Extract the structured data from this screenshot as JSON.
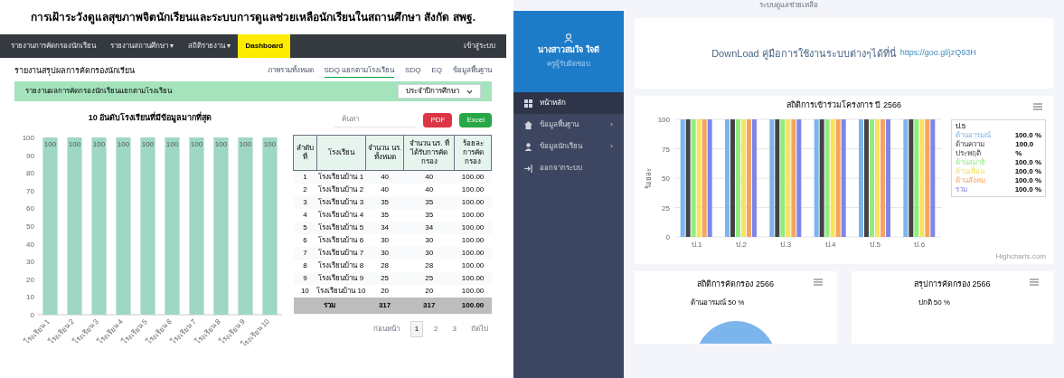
{
  "left_page": {
    "title": "การเฝ้าระวังดูแลสุขภาพจิตนักเรียนและระบบการดูแลช่วยเหลือนักเรียนในสถานศึกษา สังกัด สพฐ.",
    "nav": [
      {
        "label": "รายงานการคัดกรองนักเรียน",
        "selected": false
      },
      {
        "label": "รายงานสถานศึกษา",
        "caret": "▾",
        "selected": false
      },
      {
        "label": "สถิติรายงาน",
        "caret": "▾",
        "selected": false
      },
      {
        "label": "Dashboard",
        "selected": true
      },
      {
        "label": "เข้าสู่ระบบ",
        "selected": false
      }
    ],
    "heading": "รายงานสรุปผลการคัดกรองนักเรียน",
    "tabs": [
      {
        "label": "ภาพรวมทั้งหมด",
        "selected": false
      },
      {
        "label": "SDQ แยกตามโรงเรียน",
        "selected": true
      },
      {
        "label": "SDQ",
        "selected": false
      },
      {
        "label": "EQ",
        "selected": false
      },
      {
        "label": "ข้อมูลพื้นฐาน",
        "selected": false
      }
    ],
    "banner": "รายงานผลการคัดกรองนักเรียนแยกตามโรงเรียน",
    "select_value": "ประจำปีการศึกษา",
    "chart": {
      "chart_data": {
        "type": "bar",
        "title": "10 อันดับโรงเรียนที่มีข้อมูลมากที่สุด",
        "categories": [
          "โรงเรียน 1",
          "โรงเรียน 2",
          "โรงเรียน 3",
          "โรงเรียน 4",
          "โรงเรียน 5",
          "โรงเรียน 6",
          "โรงเรียน 7",
          "โรงเรียน 8",
          "โรงเรียน 9",
          "โรงเรียน 10"
        ],
        "values": [
          100,
          100,
          100,
          100,
          100,
          100,
          100,
          100,
          100,
          100
        ],
        "ylim": [
          0,
          100
        ],
        "yticks": [
          0,
          10,
          20,
          30,
          40,
          50,
          60,
          70,
          80,
          90,
          100
        ],
        "data_labels": true
      }
    },
    "search_placeholder": "ค้นหา",
    "buttons": [
      {
        "label": "PDF",
        "kind": "pdf"
      },
      {
        "label": "Excel",
        "kind": "excel"
      }
    ],
    "table": {
      "columns": [
        "ลำดับที่",
        "โรงเรียน",
        "จำนวน นร. ทั้งหมด",
        "จำนวน นร. ที่ได้รับการคัดกรอง",
        "ร้อยละ การคัดกรอง"
      ],
      "rows": [
        [
          "1",
          "โรงเรียนบ้าน 1",
          "40",
          "40",
          "100.00"
        ],
        [
          "2",
          "โรงเรียนบ้าน 2",
          "40",
          "40",
          "100.00"
        ],
        [
          "3",
          "โรงเรียนบ้าน 3",
          "35",
          "35",
          "100.00"
        ],
        [
          "4",
          "โรงเรียนบ้าน 4",
          "35",
          "35",
          "100.00"
        ],
        [
          "5",
          "โรงเรียนบ้าน 5",
          "34",
          "34",
          "100.00"
        ],
        [
          "6",
          "โรงเรียนบ้าน 6",
          "30",
          "30",
          "100.00"
        ],
        [
          "7",
          "โรงเรียนบ้าน 7",
          "30",
          "30",
          "100.00"
        ],
        [
          "8",
          "โรงเรียนบ้าน 8",
          "28",
          "28",
          "100.00"
        ],
        [
          "9",
          "โรงเรียนบ้าน 9",
          "25",
          "25",
          "100.00"
        ],
        [
          "10",
          "โรงเรียนบ้าน 10",
          "20",
          "20",
          "100.00"
        ]
      ],
      "total": [
        "รวม",
        "317",
        "317",
        "100.00"
      ]
    },
    "pagination": [
      {
        "label": "ก่อนหน้า",
        "selected": false
      },
      {
        "label": "1",
        "selected": true
      },
      {
        "label": "2",
        "selected": false
      },
      {
        "label": "3",
        "selected": false
      },
      {
        "label": "ถัดไป",
        "selected": false
      }
    ]
  },
  "right_page": {
    "top_text": "ระบบดูแลช่วยเหลือ",
    "profile": {
      "name": "นางสาวสมใจ ใจดี",
      "role": "ครูผู้รับผิดชอบ"
    },
    "menu": [
      {
        "label": "หน้าหลัก",
        "selected": true
      },
      {
        "label": "ข้อมูลพื้นฐาน",
        "chevron": "›",
        "selected": false
      },
      {
        "label": "ข้อมูลนักเรียน",
        "chevron": "›",
        "selected": false
      },
      {
        "label": "ออกจากระบบ",
        "selected": false
      }
    ],
    "banner": {
      "text": "DownLoad คู่มือการใช้งานระบบต่างๆได้ที่นี่",
      "link": "https://goo.gl/jzQ93H"
    },
    "chart": {
      "chart_data": {
        "type": "bar",
        "title": "สถิติการเข้าร่วมโครงการ ปี 2566",
        "ylabel": "ร้อยละ",
        "categories": [
          "ป.1",
          "ป.2",
          "ป.3",
          "ป.4",
          "ป.5",
          "ป.6"
        ],
        "ylim": [
          0,
          100
        ],
        "yticks": [
          0,
          25,
          50,
          75,
          100
        ],
        "grid": true,
        "series": [
          {
            "name": "ด้านอารมณ์",
            "color": "#7cb5ec",
            "values": [
              100,
              100,
              100,
              100,
              100,
              100
            ]
          },
          {
            "name": "ด้านความประพฤติ",
            "color": "#434348",
            "values": [
              100,
              100,
              100,
              100,
              100,
              100
            ]
          },
          {
            "name": "ด้านสมาธิ",
            "color": "#90ed7d",
            "values": [
              100,
              100,
              100,
              100,
              100,
              100
            ]
          },
          {
            "name": "ด้านเพื่อน",
            "color": "#f7e35c",
            "values": [
              100,
              100,
              100,
              100,
              100,
              100
            ]
          },
          {
            "name": "ด้านสังคม",
            "color": "#f7a35c",
            "values": [
              100,
              100,
              100,
              100,
              100,
              100
            ]
          },
          {
            "name": "รวม",
            "color": "#8085e9",
            "values": [
              100,
              100,
              100,
              100,
              100,
              100
            ]
          }
        ]
      },
      "tooltip": {
        "header": "ป.5",
        "lines": [
          "100.0 %",
          "100.0 %",
          "100.0 %",
          "100.0 %",
          "100.0 %",
          "100.0 %"
        ]
      },
      "credit": "Highcharts.com"
    },
    "cards": [
      {
        "title": "สถิติการคัดกรอง 2566",
        "label": "ด้านอารมณ์ 50 %"
      },
      {
        "title": "สรุปการคัดกรอง 2566",
        "label": "ปกติ 50 %"
      }
    ]
  }
}
